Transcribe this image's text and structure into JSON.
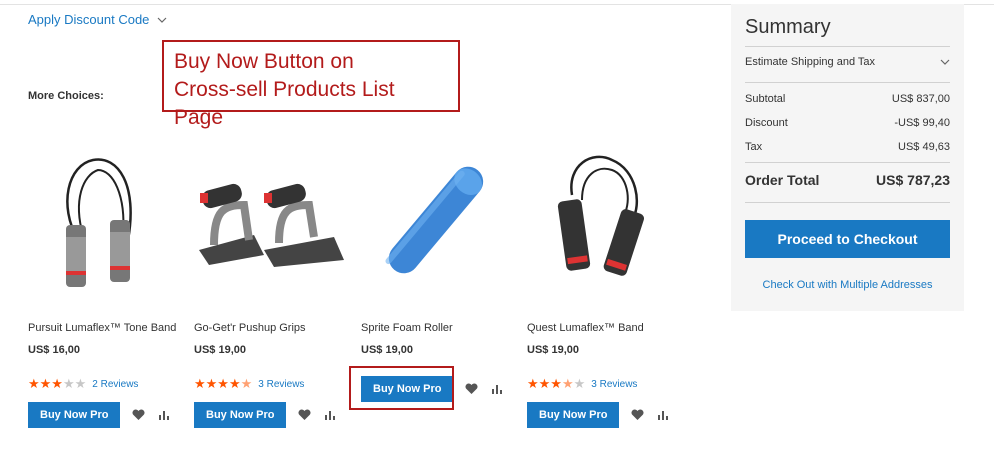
{
  "discount": {
    "label": "Apply Discount Code"
  },
  "callout": {
    "line1": "Buy Now Button on",
    "line2": "Cross-sell Products List Page"
  },
  "more_choices": {
    "heading": "More Choices:"
  },
  "products": [
    {
      "name": "Pursuit Lumaflex™ Tone Band",
      "price": "US$ 16,00",
      "rating": 3,
      "reviews": "2  Reviews",
      "button": "Buy Now Pro",
      "image": "jump-rope"
    },
    {
      "name": "Go-Get'r Pushup Grips",
      "price": "US$ 19,00",
      "rating": 4.5,
      "reviews": "3  Reviews",
      "button": "Buy Now Pro",
      "image": "pushup-grips"
    },
    {
      "name": "Sprite Foam Roller",
      "price": "US$ 19,00",
      "rating": null,
      "reviews": "",
      "button": "Buy Now Pro",
      "image": "foam-roller"
    },
    {
      "name": "Quest Lumaflex™ Band",
      "price": "US$ 19,00",
      "rating": 3.5,
      "reviews": "3  Reviews",
      "button": "Buy Now Pro",
      "image": "jump-rope"
    }
  ],
  "summary": {
    "title": "Summary",
    "estimate_label": "Estimate Shipping and Tax",
    "subtotal_label": "Subtotal",
    "subtotal_value": "US$ 837,00",
    "discount_label": "Discount",
    "discount_value": "-US$ 99,40",
    "tax_label": "Tax",
    "tax_value": "US$ 49,63",
    "total_label": "Order Total",
    "total_value": "US$ 787,23",
    "checkout_label": "Proceed to Checkout",
    "multi_label": "Check Out with Multiple Addresses"
  },
  "colors": {
    "accent": "#1979c3",
    "star": "#ff5501",
    "callout": "#b31b1b",
    "summary_bg": "#f5f5f5"
  }
}
